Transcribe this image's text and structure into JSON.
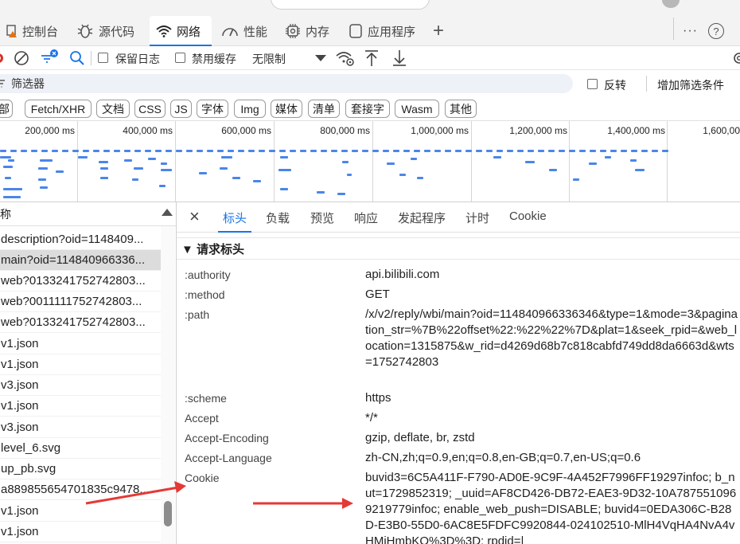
{
  "tabs": {
    "console": "控制台",
    "sources": "源代码",
    "network": "网络",
    "performance": "性能",
    "memory": "内存",
    "application": "应用程序",
    "add": "+",
    "more": "···",
    "help": "?"
  },
  "toolbar": {
    "preserve_log": "保留日志",
    "disable_cache": "禁用缓存",
    "throttling": "无限制"
  },
  "filter": {
    "placeholder": "筛选器",
    "invert": "反转",
    "more_filters": "增加筛选条件"
  },
  "types": [
    "部",
    "Fetch/XHR",
    "文档",
    "CSS",
    "JS",
    "字体",
    "Img",
    "媒体",
    "清单",
    "套接字",
    "Wasm",
    "其他"
  ],
  "timeline": {
    "ticks": [
      "200,000 ms",
      "400,000 ms",
      "600,000 ms",
      "800,000 ms",
      "1,000,000 ms",
      "1,200,000 ms",
      "1,400,000 ms",
      "1,600,00"
    ]
  },
  "requests": {
    "header": "称",
    "rows": [
      "description?oid=1148409...",
      "main?oid=114840966336...",
      "web?0133241752742803...",
      "web?0011111752742803...",
      "web?0133241752742803...",
      "v1.json",
      "v1.json",
      "v3.json",
      "v1.json",
      "v3.json",
      "level_6.svg",
      "up_pb.svg",
      "a889855654701835c9478...",
      "v1.json",
      "v1.json"
    ],
    "selected_index": 1
  },
  "details": {
    "close": "×",
    "tabs": [
      "标头",
      "负载",
      "预览",
      "响应",
      "发起程序",
      "计时",
      "Cookie"
    ],
    "section": "▼ 请求标头",
    "headers": [
      {
        "name": ":authority",
        "value": "api.bilibili.com"
      },
      {
        "name": ":method",
        "value": "GET"
      },
      {
        "name": ":path",
        "value": "/x/v2/reply/wbi/main?oid=114840966336346&type=1&mode=3&pagination_str=%7B%22offset%22:%22%22%7D&plat=1&seek_rpid=&web_location=1315875&w_rid=d4269d68b7c818cabfd749dd8da6663d&wts=1752742803"
      },
      {
        "name": ":scheme",
        "value": "https"
      },
      {
        "name": "Accept",
        "value": "*/*"
      },
      {
        "name": "Accept-Encoding",
        "value": "gzip, deflate, br, zstd"
      },
      {
        "name": "Accept-Language",
        "value": "zh-CN,zh;q=0.9,en;q=0.8,en-GB;q=0.7,en-US;q=0.6"
      },
      {
        "name": "Cookie",
        "value": "buvid3=6C5A411F-F790-AD0E-9C9F-4A452F7996FF19297infoc; b_nut=1729852319; _uuid=AF8CD426-DB72-EAE3-9D32-10A7875510969219779infoc; enable_web_push=DISABLE; buvid4=0EDA306C-B28D-E3B0-55D0-6AC8E5FDFC9920844-024102510-MlH4VqHA4NvA4vHMjHmbKQ%3D%3D; rpdid=|"
      }
    ]
  },
  "colors": {
    "accent": "#1a73e8",
    "arrow": "#e53935",
    "timeline_bar": "#4a86e8"
  }
}
